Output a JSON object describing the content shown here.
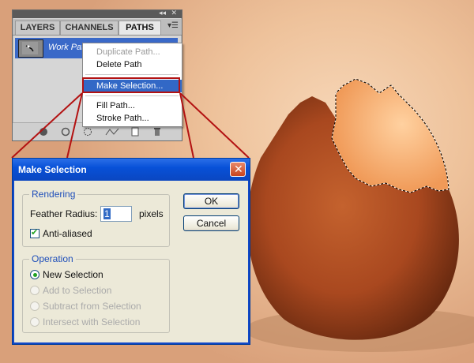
{
  "panel": {
    "tabs": [
      "LAYERS",
      "CHANNELS",
      "PATHS"
    ],
    "active_tab": "PATHS",
    "path_name": "Work Path"
  },
  "context_menu": {
    "items": [
      {
        "label": "Duplicate Path...",
        "disabled": true
      },
      {
        "label": "Delete Path",
        "disabled": false
      },
      {
        "label": "Make Selection...",
        "highlighted": true
      },
      {
        "label": "Fill Path...",
        "disabled": false
      },
      {
        "label": "Stroke Path...",
        "disabled": false
      }
    ]
  },
  "dialog": {
    "title": "Make Selection",
    "rendering": {
      "group_label": "Rendering",
      "feather_label": "Feather Radius:",
      "feather_value": "1",
      "feather_unit": "pixels",
      "antialiased_label": "Anti-aliased",
      "antialiased_checked": true
    },
    "operation": {
      "group_label": "Operation",
      "options": [
        {
          "label": "New Selection",
          "selected": true,
          "enabled": true
        },
        {
          "label": "Add to Selection",
          "selected": false,
          "enabled": false
        },
        {
          "label": "Subtract from Selection",
          "selected": false,
          "enabled": false
        },
        {
          "label": "Intersect with Selection",
          "selected": false,
          "enabled": false
        }
      ]
    },
    "ok_label": "OK",
    "cancel_label": "Cancel"
  },
  "colors": {
    "highlight": "#3268c6",
    "callout_lines": "#b31212",
    "dialog_title": "#0851d8"
  }
}
